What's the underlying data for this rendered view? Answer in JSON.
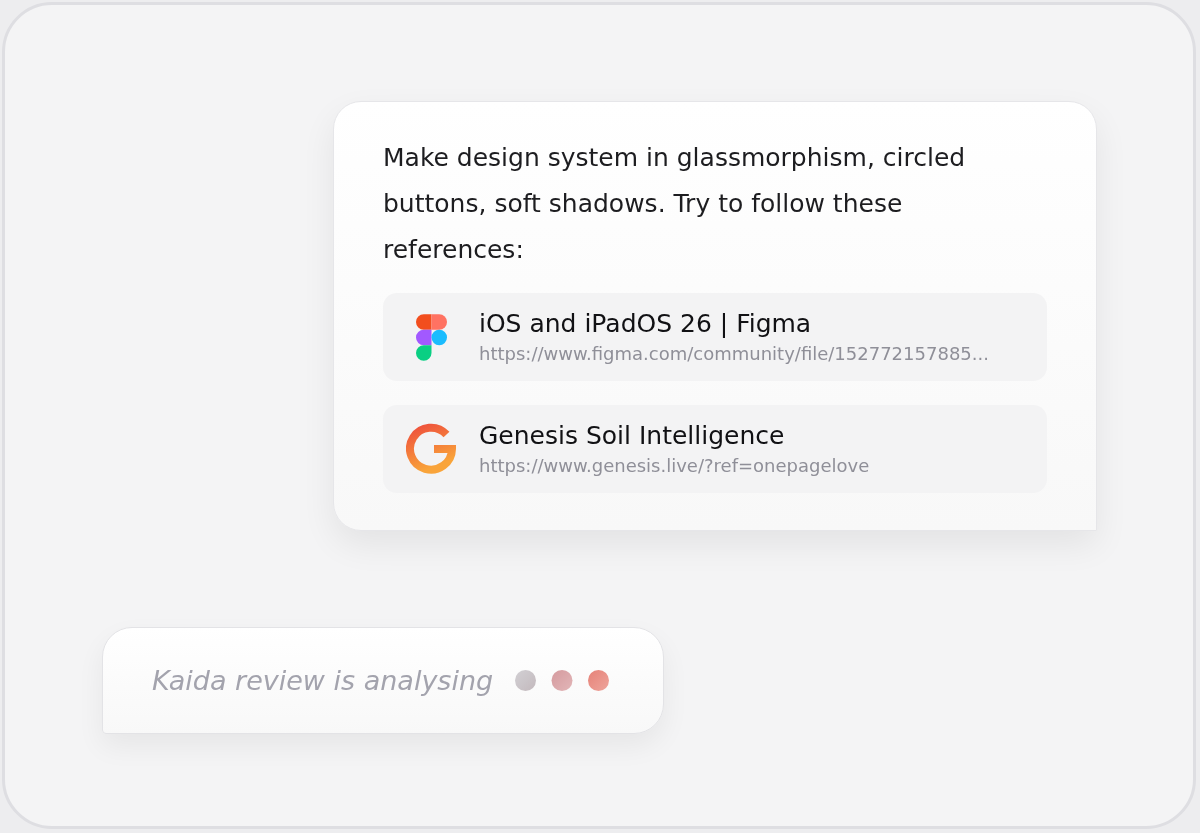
{
  "message": {
    "text": "Make design system in glassmorphism, circled buttons, soft shadows. Try to follow these references:",
    "references": [
      {
        "kind": "figma",
        "title": "iOS and iPadOS 26 | Figma",
        "url": "https://www.figma.com/community/file/152772157885..."
      },
      {
        "kind": "genesis",
        "title": "Genesis Soil Intelligence",
        "url": "https://www.genesis.live/?ref=onepagelove"
      }
    ]
  },
  "status": {
    "text": "Kaida review is analysing"
  }
}
